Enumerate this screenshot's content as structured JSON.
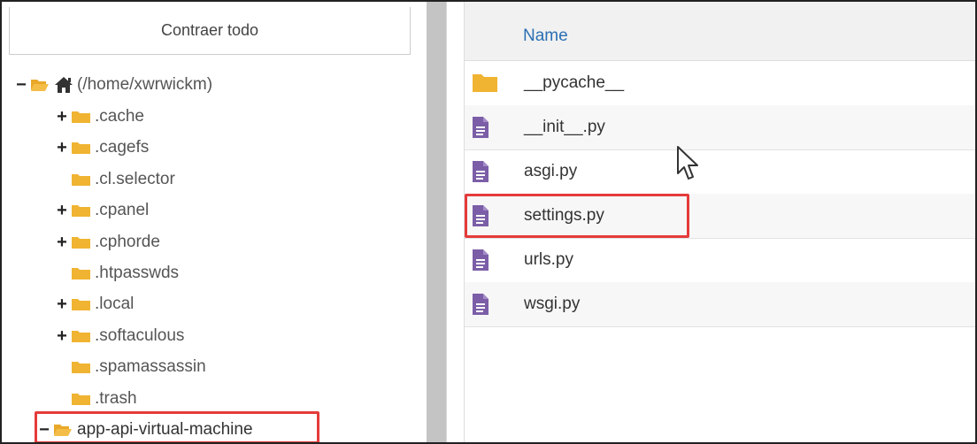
{
  "tree": {
    "collapse_label": "Contraer todo",
    "root": {
      "toggle": "−",
      "label": "(/home/xwrwickm)",
      "icon": "home-icon"
    },
    "items": [
      {
        "toggle": "+",
        "label": ".cache"
      },
      {
        "toggle": "+",
        "label": ".cagefs"
      },
      {
        "toggle": "",
        "label": ".cl.selector"
      },
      {
        "toggle": "+",
        "label": ".cpanel"
      },
      {
        "toggle": "+",
        "label": ".cphorde"
      },
      {
        "toggle": "",
        "label": ".htpasswds"
      },
      {
        "toggle": "+",
        "label": ".local"
      },
      {
        "toggle": "+",
        "label": ".softaculous"
      },
      {
        "toggle": "",
        "label": ".spamassassin"
      },
      {
        "toggle": "",
        "label": ".trash"
      },
      {
        "toggle": "−",
        "label": "app-api-virtual-machine",
        "highlighted": true
      }
    ]
  },
  "list": {
    "column_header": "Name",
    "files": [
      {
        "name": "__pycache__",
        "type": "folder"
      },
      {
        "name": "__init__.py",
        "type": "file"
      },
      {
        "name": "asgi.py",
        "type": "file"
      },
      {
        "name": "settings.py",
        "type": "file",
        "highlighted": true
      },
      {
        "name": "urls.py",
        "type": "file"
      },
      {
        "name": "wsgi.py",
        "type": "file"
      }
    ]
  },
  "colors": {
    "folder": "#f0b432",
    "file_icon": "#7b5ea7",
    "highlight": "#e53b3b",
    "header_link": "#2a6fb3"
  }
}
